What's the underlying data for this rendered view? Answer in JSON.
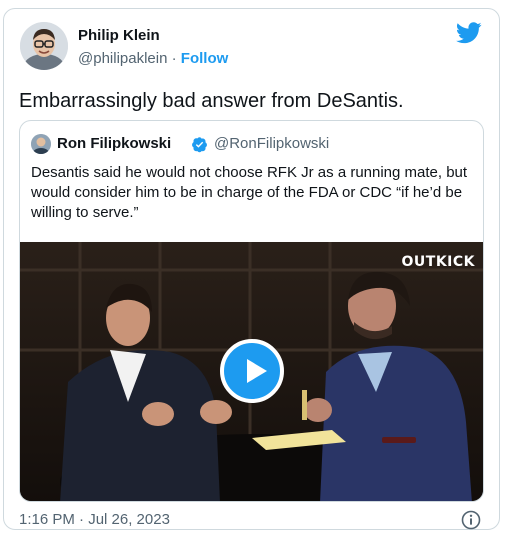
{
  "author": {
    "name": "Philip Klein",
    "handle": "@philipaklein",
    "separator": " · ",
    "follow_label": "Follow"
  },
  "tweet": {
    "text": "Embarrassingly bad answer from DeSantis.",
    "timestamp": "1:16 PM · Jul 26, 2023"
  },
  "quoted_tweet": {
    "name": "Ron Filipkowski",
    "handle": "@RonFilipkowski",
    "verified": true,
    "text": "Desantis said he would not choose RFK Jr as a running mate, but would consider him to be in charge of the FDA or CDC “if he’d be willing to serve.”",
    "media": {
      "type": "video",
      "watermark": "OUTKICK"
    }
  },
  "icons": {
    "bird": "twitter-bird-icon",
    "verified": "verified-badge-icon",
    "play": "play-icon",
    "info": "info-icon"
  },
  "colors": {
    "accent": "#1d9bf0",
    "text": "#0f1419",
    "secondary": "#536471",
    "border": "#cfd9de"
  }
}
